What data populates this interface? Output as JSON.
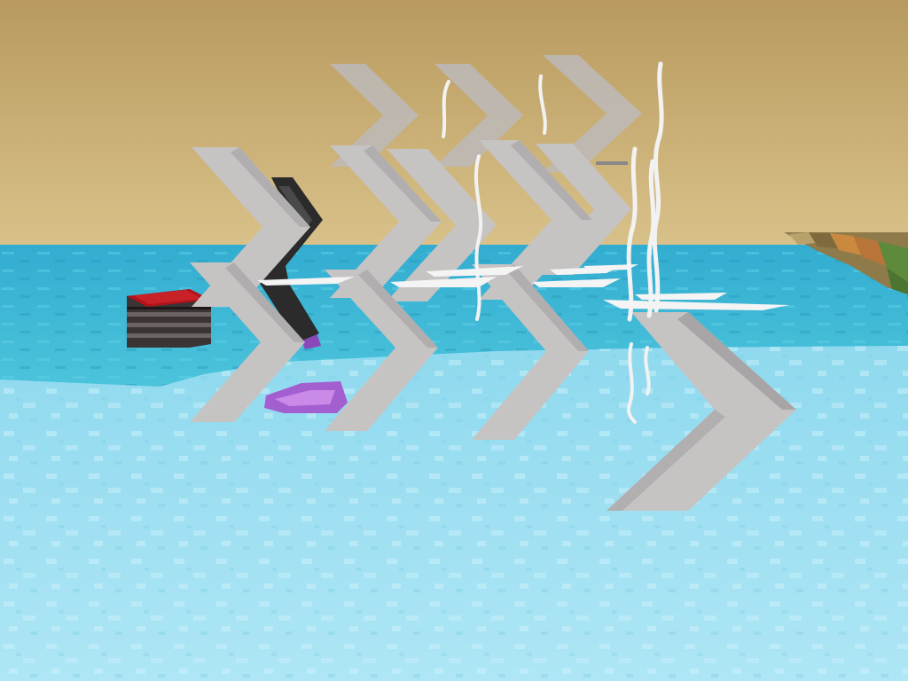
{
  "scene": {
    "type": "voxel-world-view",
    "hud_visible": false,
    "visible_text": [],
    "objects": [
      "sky",
      "ocean",
      "shallow-water-floor",
      "block-path",
      "note-block",
      "amethyst-cluster",
      "black-chevron-item",
      "gray-chevron-items",
      "white-feather-items"
    ]
  },
  "colors": {
    "sky_top": "#b89a5f",
    "sky_bottom": "#d6bf86",
    "ocean": "#3cb6d3",
    "ocean_dark": "#2aa1c2",
    "floor": "#9fe1f2",
    "floor_light": "#c2eef9",
    "chevron_gray": "#c6c3c3",
    "chevron_shade": "#a8a5a6",
    "chevron_black": "#2b2b2b",
    "amethyst": "#a35fd0",
    "note_block_red": "#b3121a",
    "note_block_dark": "#3a3435",
    "feather_white": "#f2f2f2"
  }
}
